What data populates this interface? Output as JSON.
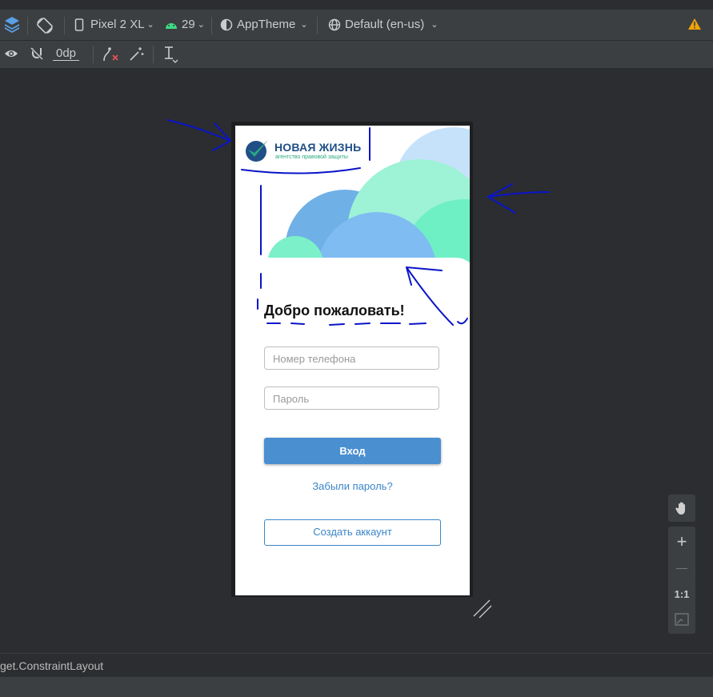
{
  "toolbar": {
    "device": "Pixel 2 XL",
    "api_level": "29",
    "theme": "AppTheme",
    "locale": "Default (en-us)",
    "margin_value": "0dp"
  },
  "app": {
    "logo_title": "НОВАЯ ЖИЗНЬ",
    "logo_subtitle": "агентство правовой защиты",
    "welcome": "Добро пожаловать!",
    "phone_placeholder": "Номер телефона",
    "password_placeholder": "Пароль",
    "login_label": "Вход",
    "forgot_label": "Забыли пароль?",
    "create_label": "Создать аккаунт"
  },
  "zoom": {
    "plus": "+",
    "minus": "—",
    "one_to_one": "1:1"
  },
  "status": {
    "component": "get.ConstraintLayout"
  },
  "colors": {
    "accent": "#4a8fd0",
    "link": "#3b86c8",
    "warning": "#f0a30a",
    "annotation": "#0a14c8"
  }
}
